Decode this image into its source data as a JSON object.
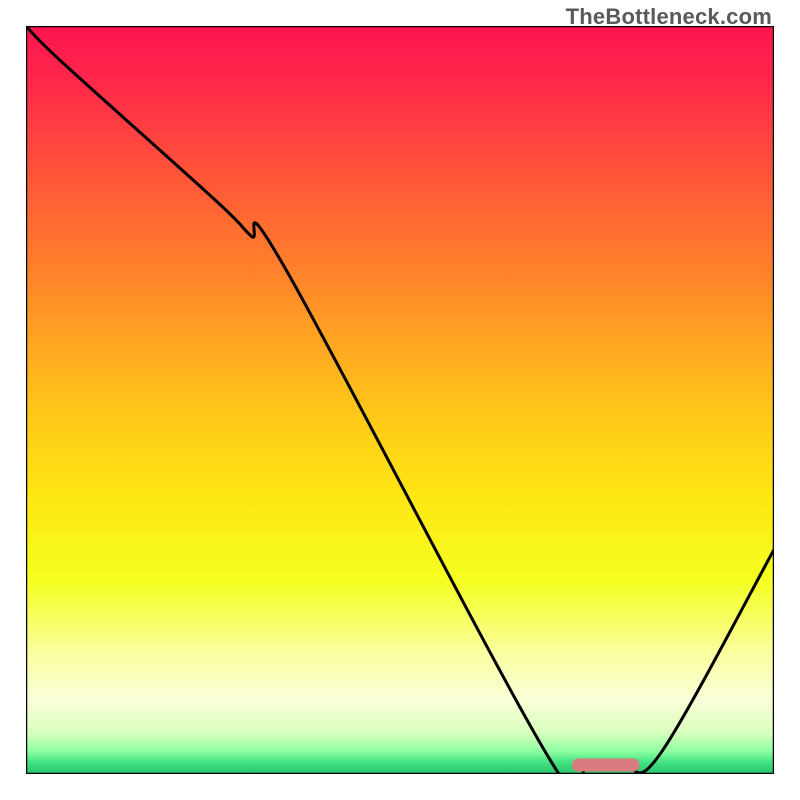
{
  "watermark": "TheBottleneck.com",
  "chart_data": {
    "type": "line",
    "title": "",
    "xlabel": "",
    "ylabel": "",
    "xlim": [
      0,
      100
    ],
    "ylim": [
      0,
      100
    ],
    "grid": false,
    "legend": false,
    "series": [
      {
        "name": "bottleneck-curve",
        "x": [
          0,
          5,
          25,
          30,
          35,
          70,
          75,
          80,
          85,
          100
        ],
        "y": [
          100,
          95,
          77,
          72,
          67,
          2,
          1,
          1,
          3,
          30
        ]
      }
    ],
    "marker": {
      "name": "optimal-range",
      "x_start": 73,
      "x_end": 82,
      "y": 1.2,
      "color": "#d97b7f"
    },
    "gradient_stops": [
      {
        "offset": 0.0,
        "color": "#ff1450"
      },
      {
        "offset": 0.08,
        "color": "#ff2a4a"
      },
      {
        "offset": 0.2,
        "color": "#ff5538"
      },
      {
        "offset": 0.35,
        "color": "#ff8a28"
      },
      {
        "offset": 0.5,
        "color": "#ffc21a"
      },
      {
        "offset": 0.62,
        "color": "#ffe414"
      },
      {
        "offset": 0.74,
        "color": "#f5ff20"
      },
      {
        "offset": 0.84,
        "color": "#f9ffa0"
      },
      {
        "offset": 0.9,
        "color": "#fbffd8"
      },
      {
        "offset": 0.945,
        "color": "#d8ffbf"
      },
      {
        "offset": 0.97,
        "color": "#8cffa0"
      },
      {
        "offset": 0.985,
        "color": "#40e080"
      },
      {
        "offset": 1.0,
        "color": "#2bc46e"
      }
    ]
  }
}
